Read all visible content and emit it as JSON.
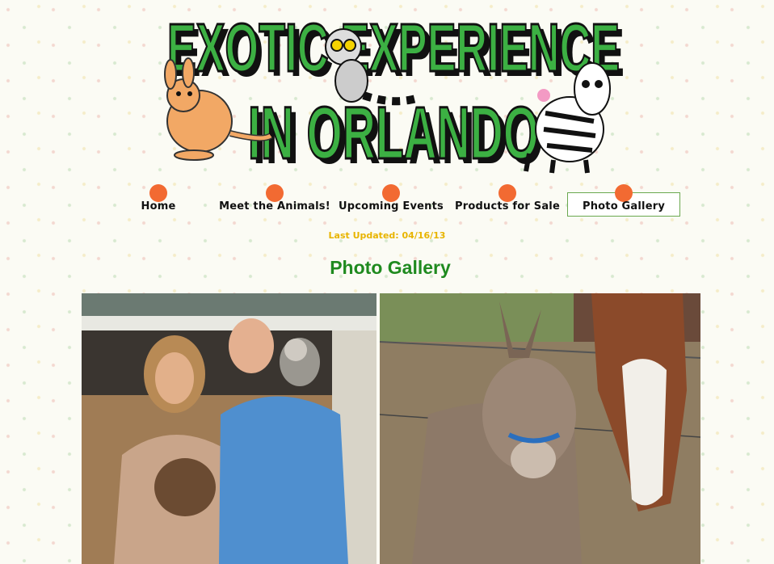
{
  "banner": {
    "line1": "EXOTIC EXPERIENCE",
    "line2": "IN ORLANDO"
  },
  "nav": [
    {
      "label": "Home"
    },
    {
      "label": "Meet the Animals!"
    },
    {
      "label": "Upcoming Events"
    },
    {
      "label": "Products for Sale"
    },
    {
      "label": "Photo Gallery"
    }
  ],
  "updated": "Last Updated:  04/16/13",
  "page_title": "Photo Gallery",
  "colors": {
    "nav_dot": "#f26a32",
    "title": "#1f8a1f",
    "updated": "#e8b400",
    "logo_green": "#3cb043"
  }
}
